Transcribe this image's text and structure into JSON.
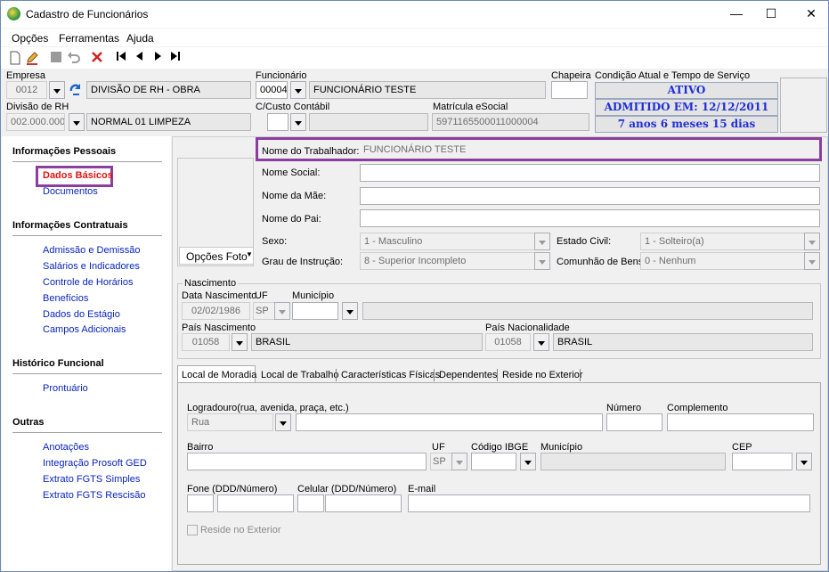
{
  "window": {
    "title": "Cadastro de Funcionários",
    "minimize": "—",
    "maximize": "☐",
    "close": "✕"
  },
  "menu": [
    {
      "label": "Opções"
    },
    {
      "label": "Ferramentas"
    },
    {
      "label": "Ajuda"
    }
  ],
  "header": {
    "empresa_label": "Empresa",
    "empresa_code": "0012",
    "empresa_name": "DIVISÃO DE RH - OBRA",
    "divisao_label": "Divisão de RH",
    "divisao_code": "002.000.000",
    "divisao_name": "NORMAL 01 LIMPEZA",
    "funcionario_label": "Funcionário",
    "funcionario_code": "00004",
    "funcionario_name": "FUNCIONÁRIO TESTE",
    "custo_label": "C/Custo Contábil",
    "custo_code": "",
    "custo_name": "",
    "matricula_label": "Matrícula eSocial",
    "matricula_value": "5971165500011000004",
    "chapeira_label": "Chapeira",
    "chapeira_value": "",
    "condicao_label": "Condição Atual e Tempo de Serviço",
    "status_1": "ATIVO",
    "status_2": "ADMITIDO EM: 12/12/2011",
    "status_3": "7 anos 6 meses 15 dias"
  },
  "sidebar": {
    "sections": [
      {
        "title": "Informações Pessoais",
        "items": [
          "Dados Básicos",
          "Documentos"
        ]
      },
      {
        "title": "Informações Contratuais",
        "items": [
          "Admissão e Demissão",
          "Salários e Indicadores",
          "Controle de Horários",
          "Benefícios",
          "Dados do Estágio",
          "Campos Adicionais"
        ]
      },
      {
        "title": "Histórico Funcional",
        "items": [
          "Prontuário"
        ]
      },
      {
        "title": "Outras",
        "items": [
          "Anotações",
          "Integração Prosoft GED",
          "Extrato FGTS Simples",
          "Extrato FGTS Rescisão"
        ]
      }
    ]
  },
  "form": {
    "opcoes_foto": "Opções Foto",
    "nome_trabalhador_label": "Nome do Trabalhador:",
    "nome_trabalhador_value": "FUNCIONÁRIO TESTE",
    "nome_social_label": "Nome Social:",
    "nome_mae_label": "Nome da Mãe:",
    "nome_pai_label": "Nome do Pai:",
    "sexo_label": "Sexo:",
    "sexo_value": "1 - Masculino",
    "estado_civil_label": "Estado Civil:",
    "estado_civil_value": "1 - Solteiro(a)",
    "grau_label": "Grau de Instrução:",
    "grau_value": "8 - Superior Incompleto",
    "comunhao_label": "Comunhão de Bens:",
    "comunhao_value": "0 - Nenhum"
  },
  "nascimento": {
    "legend": "Nascimento",
    "data_label": "Data Nascimento",
    "data_value": "02/02/1986",
    "uf_label": "UF",
    "uf_value": "SP",
    "municipio_label": "Município",
    "pais_nasc_label": "País Nascimento",
    "pais_nasc_code": "01058",
    "pais_nasc_name": "BRASIL",
    "pais_nac_label": "País Nacionalidade",
    "pais_nac_code": "01058",
    "pais_nac_name": "BRASIL"
  },
  "tabs": [
    {
      "label": "Local de Moradia"
    },
    {
      "label": "Local de Trabalho"
    },
    {
      "label": "Características Físicas"
    },
    {
      "label": "Dependentes"
    },
    {
      "label": "Reside no Exterior"
    }
  ],
  "moradia": {
    "logradouro_label": "Logradouro(rua, avenida, praça, etc.)",
    "logradouro_tipo": "Rua",
    "numero_label": "Número",
    "complemento_label": "Complemento",
    "bairro_label": "Bairro",
    "uf_label": "UF",
    "uf_value": "SP",
    "ibge_label": "Código IBGE",
    "municipio_label": "Município",
    "cep_label": "CEP",
    "fone_label": "Fone (DDD/Número)",
    "celular_label": "Celular (DDD/Número)",
    "email_label": "E-mail",
    "reside_exterior_label": "Reside no Exterior"
  }
}
